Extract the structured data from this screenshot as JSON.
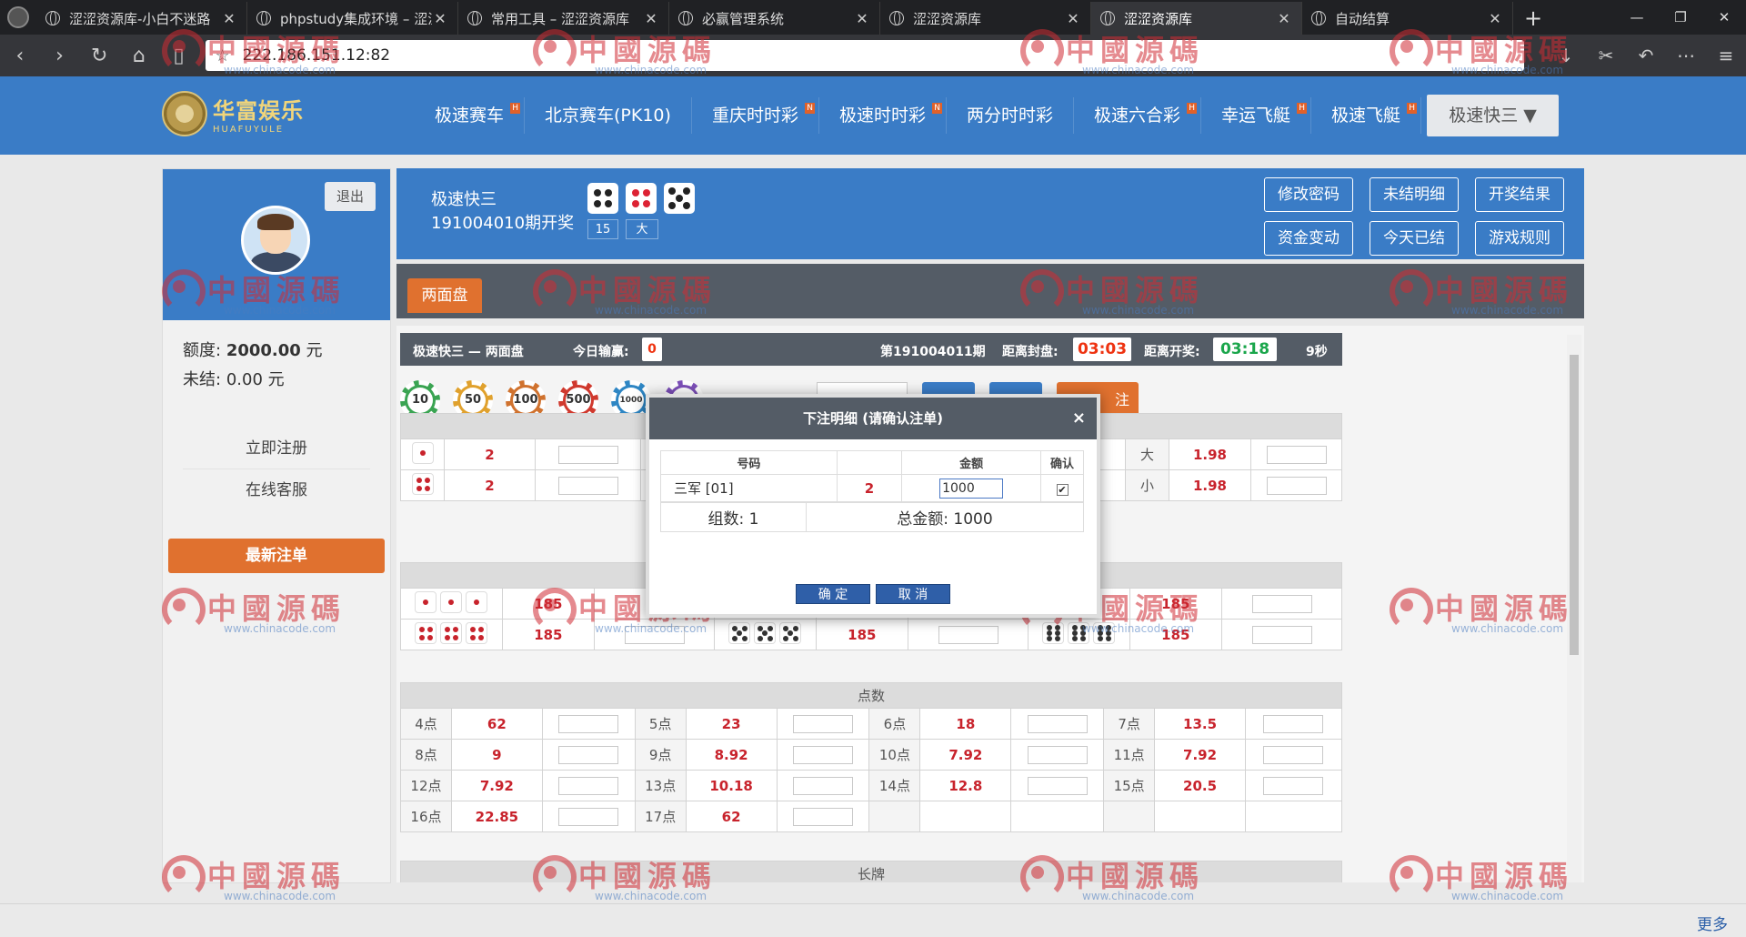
{
  "browser": {
    "tabs": [
      {
        "label": "涩涩资源库-小白不迷路",
        "active": false
      },
      {
        "label": "phpstudy集成环境 – 涩涩",
        "active": false
      },
      {
        "label": "常用工具 – 涩涩资源库",
        "active": false
      },
      {
        "label": "必赢管理系统",
        "active": false
      },
      {
        "label": "涩涩资源库",
        "active": false
      },
      {
        "label": "涩涩资源库",
        "active": true
      },
      {
        "label": "自动结算",
        "active": false
      }
    ],
    "url": "222.186.151.12:82"
  },
  "site": {
    "logo_cn": "华富娱乐",
    "logo_en": "HUAFUYULE",
    "nav": [
      {
        "label": "极速赛车",
        "badge": "H"
      },
      {
        "label": "北京赛车(PK10)",
        "badge": ""
      },
      {
        "label": "重庆时时彩",
        "badge": "N"
      },
      {
        "label": "极速时时彩",
        "badge": "N"
      },
      {
        "label": "两分时时彩",
        "badge": ""
      },
      {
        "label": "极速六合彩",
        "badge": "H"
      },
      {
        "label": "幸运飞艇",
        "badge": "H"
      },
      {
        "label": "极速飞艇",
        "badge": "H"
      }
    ],
    "nav_dropdown": "极速快三 ▼"
  },
  "sidebar": {
    "logout": "退出",
    "username": "",
    "credit_label": "额度:",
    "credit_value": "2000.00",
    "credit_unit": "元",
    "unsettled_label": "未结:",
    "unsettled_value": "0.00",
    "unsettled_unit": "元",
    "links": [
      "立即注册",
      "在线客服"
    ],
    "latest_button": "最新注单"
  },
  "game": {
    "name": "极速快三",
    "period_text": "191004010期开奖",
    "result_sum": "15",
    "result_size": "大",
    "actions": [
      "修改密码",
      "未结明细",
      "开奖结果",
      "资金变动",
      "今天已结",
      "游戏规则"
    ],
    "play_tab": "两面盘"
  },
  "bar": {
    "left": "极速快三 — 两面盘",
    "today_label": "今日输赢:",
    "today_value": "0",
    "period": "第191004011期",
    "seal_label": "距离封盘:",
    "seal_value": "03:03",
    "draw_label": "距离开奖:",
    "draw_value": "03:18",
    "refresh": "9秒"
  },
  "chips": [
    "10",
    "50",
    "100",
    "500",
    "1000",
    ""
  ],
  "bet_button_partial": "注",
  "single": {
    "rows": [
      {
        "odds": "2"
      },
      {
        "odds": "2"
      }
    ],
    "size": [
      {
        "label": "大",
        "odds": "1.98"
      },
      {
        "label": "小",
        "odds": "1.98"
      }
    ]
  },
  "triples": {
    "row1_odds_a": "185",
    "row1_odds_c": "185",
    "row2": [
      "185",
      "185",
      "185"
    ]
  },
  "points": {
    "title": "点数",
    "rows": [
      [
        {
          "label": "4点",
          "odds": "62"
        },
        {
          "label": "5点",
          "odds": "23"
        },
        {
          "label": "6点",
          "odds": "18"
        },
        {
          "label": "7点",
          "odds": "13.5"
        }
      ],
      [
        {
          "label": "8点",
          "odds": "9"
        },
        {
          "label": "9点",
          "odds": "8.92"
        },
        {
          "label": "10点",
          "odds": "7.92"
        },
        {
          "label": "11点",
          "odds": "7.92"
        }
      ],
      [
        {
          "label": "12点",
          "odds": "7.92"
        },
        {
          "label": "13点",
          "odds": "10.18"
        },
        {
          "label": "14点",
          "odds": "12.8"
        },
        {
          "label": "15点",
          "odds": "20.5"
        }
      ],
      [
        {
          "label": "16点",
          "odds": "22.85"
        },
        {
          "label": "17点",
          "odds": "62"
        },
        {
          "label": "",
          "odds": ""
        },
        {
          "label": "",
          "odds": ""
        }
      ]
    ]
  },
  "long_title": "长牌",
  "modal": {
    "title": "下注明细 (请确认注单)",
    "close": "×",
    "col_number": "号码",
    "col_amount": "金额",
    "col_confirm": "确认",
    "row_number": "三军 [01]",
    "row_odds": "2",
    "row_amount": "1000",
    "row_check": "✔",
    "groups": "组数:  1",
    "total": "总金额:  1000",
    "ok": "确 定",
    "cancel": "取 消"
  },
  "watermark": {
    "text": "中國源碼",
    "url": "www.chinacode.com"
  },
  "status": {
    "more": "更多"
  }
}
